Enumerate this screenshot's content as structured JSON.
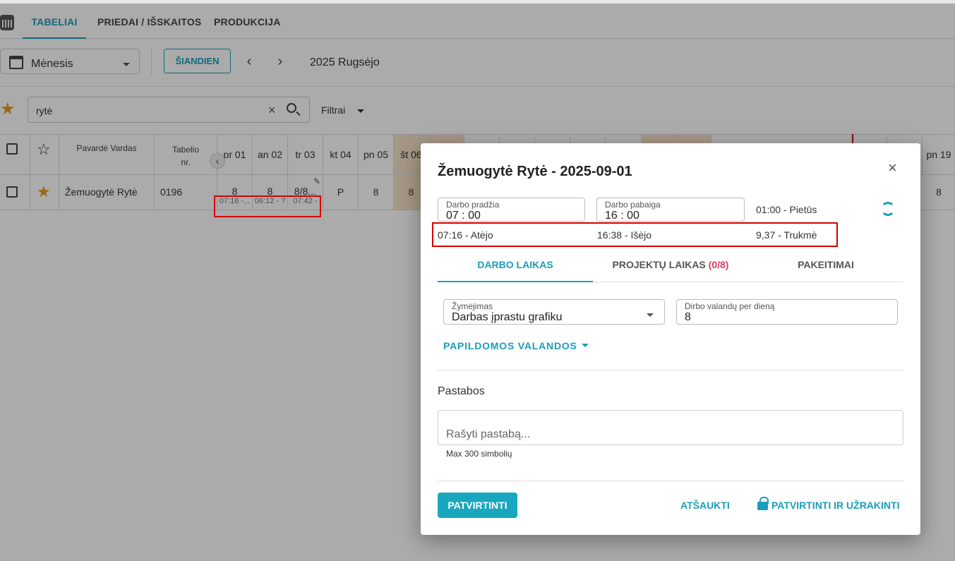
{
  "tabs": [
    "TABELIAI",
    "PRIEDAI / IŠSKAITOS",
    "PRODUKCIJA"
  ],
  "toolbar": {
    "view": "Mėnesis",
    "today": "ŠIANDIEN",
    "prev": "‹",
    "next": "›",
    "period": "2025 Rugsėjo"
  },
  "search": {
    "value": "rytė",
    "clear": "×",
    "filters": "Filtrai"
  },
  "table": {
    "name_header": "Pavardė Vardas",
    "tab_header_1": "Tabelio",
    "tab_header_2": "nr.",
    "days": [
      "pr 01",
      "an 02",
      "tr 03",
      "kt 04",
      "pn 05",
      "št 06",
      "pn 19"
    ],
    "row": {
      "name": "Žemuogytė Rytė",
      "tab_no": "0196",
      "vals": [
        "8",
        "8",
        "8/8...",
        "P",
        "8",
        "8",
        "8"
      ],
      "subs": [
        "07:16 -...",
        "06:12 - ?",
        "07:42 -"
      ]
    }
  },
  "dialog": {
    "title": "Žemuogytė Rytė - 2025-09-01",
    "close": "×",
    "start_label": "Darbo pradžia",
    "start_value": "07 : 00",
    "end_label": "Darbo pabaiga",
    "end_value": "16 : 00",
    "lunch": "01:00 - Pietūs",
    "arrived": "07:16 -  Atėjo",
    "left": "16:38 -  Išėjo",
    "duration": "9,37 -  Trukmė",
    "tab_work": "DARBO LAIKAS",
    "tab_projects": "PROJEKTŲ LAIKAS",
    "tab_projects_count": "(0/8)",
    "tab_changes": "PAKEITIMAI",
    "mark_label": "Žymėjimas",
    "mark_value": "Darbas įprastu grafiku",
    "hours_label": "Dirbo valandų per dieną",
    "hours_value": "8",
    "extra_hours": "PAPILDOMOS VALANDOS",
    "notes_title": "Pastabos",
    "notes_placeholder": "Rašyti pastabą...",
    "notes_hint": "Max 300 simbolių",
    "confirm": "PATVIRTINTI",
    "cancel": "ATŠAUKTI",
    "confirm_lock": "PATVIRTINTI IR UŽRAKINTI"
  },
  "colors": {
    "accent": "#1a9db8",
    "highlight": "#d40000",
    "star": "#e69a1f",
    "count": "#e23c5a"
  },
  "icons": [
    "calendar-icon",
    "star-icon",
    "search-icon",
    "close-icon",
    "sync-icon",
    "lock-icon",
    "edit-icon"
  ]
}
